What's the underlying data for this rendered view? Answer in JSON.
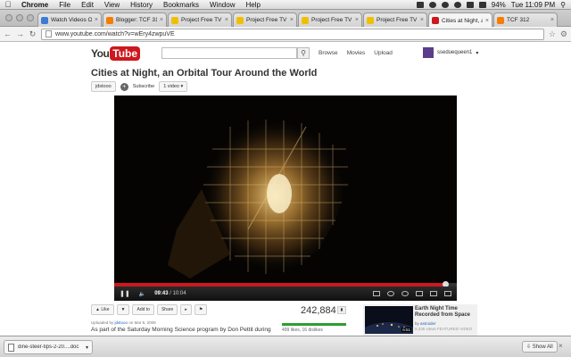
{
  "menubar": {
    "apple": "",
    "items": [
      "Chrome",
      "File",
      "Edit",
      "View",
      "History",
      "Bookmarks",
      "Window",
      "Help"
    ],
    "battery": "94%",
    "clock": "Tue 11:09 PM"
  },
  "tabs": [
    {
      "title": "Watch Videos On",
      "color": "#3a7bd5"
    },
    {
      "title": "Blogger: TCF 312",
      "color": "#f57d00"
    },
    {
      "title": "Project Free TV",
      "color": "#f0c000"
    },
    {
      "title": "Project Free TV",
      "color": "#f0c000"
    },
    {
      "title": "Project Free TV",
      "color": "#f0c000"
    },
    {
      "title": "Project Free TV",
      "color": "#f0c000"
    },
    {
      "title": "Cities at Night, an",
      "color": "#cc181e",
      "active": true
    },
    {
      "title": "TCF 312",
      "color": "#f57d00"
    }
  ],
  "omnibox": {
    "url": "www.youtube.com/watch?v=wEry4zwpuVE"
  },
  "youtube": {
    "logo_you": "You",
    "logo_tube": "Tube",
    "nav": [
      "Browse",
      "Movies",
      "Upload"
    ],
    "username": "sseduequeen1"
  },
  "video": {
    "title": "Cities at Night, an Orbital Tour Around the World",
    "channel": "jdstooo",
    "subscribe_label": "Subscribe",
    "video_count": "1 video",
    "current_time": "09:43",
    "duration": "10:04",
    "progress": 0.965
  },
  "actions": {
    "like": "Like",
    "add_to": "Add to",
    "share": "Share"
  },
  "stats": {
    "views": "242,884",
    "likes_dislikes": "499 likes, 16 dislikes",
    "uploader_prefix": "Uploaded by",
    "uploader": "jdstooo",
    "upload_date": "on Mar 6, 2009",
    "description": "As part of the Saturday Morning Science program by Don Pettit during"
  },
  "related": {
    "title": "Earth Night Time Recorded from Space",
    "by_prefix": "by",
    "author": "astroider",
    "views": "9,335 views",
    "badge": "FEATURED VIDEO",
    "duration": "6:51"
  },
  "downloads": {
    "file": "dine-steer-tips-2-20....doc",
    "show_all": "Show All"
  }
}
